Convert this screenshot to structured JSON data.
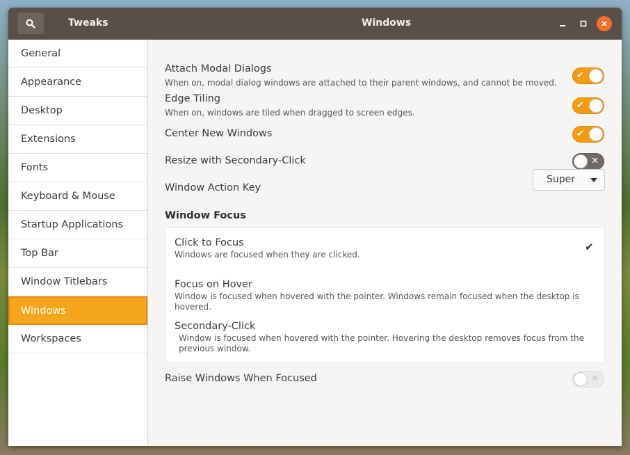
{
  "titlebar": {
    "app_title": "Tweaks",
    "page_title": "Windows",
    "search_icon": "search-icon",
    "minimize_icon": "minimize-icon",
    "maximize_icon": "maximize-icon",
    "close_icon": "close-icon",
    "close_color": "#ef6f2d"
  },
  "sidebar": {
    "items": [
      {
        "label": "General"
      },
      {
        "label": "Appearance"
      },
      {
        "label": "Desktop"
      },
      {
        "label": "Extensions"
      },
      {
        "label": "Fonts"
      },
      {
        "label": "Keyboard & Mouse"
      },
      {
        "label": "Startup Applications"
      },
      {
        "label": "Top Bar"
      },
      {
        "label": "Window Titlebars"
      },
      {
        "label": "Windows"
      },
      {
        "label": "Workspaces"
      }
    ],
    "active": "Windows",
    "active_color": "#f5a51c"
  },
  "settings": {
    "attach_modal": {
      "title": "Attach Modal Dialogs",
      "subtitle": "When on, modal dialog windows are attached to their parent windows, and cannot be moved.",
      "state": "on"
    },
    "edge_tiling": {
      "title": "Edge Tiling",
      "subtitle": "When on, windows are tiled when dragged to screen edges.",
      "state": "on"
    },
    "center_new": {
      "title": "Center New Windows",
      "state": "on"
    },
    "resize_secondary": {
      "title": "Resize with Secondary-Click",
      "state": "off"
    },
    "window_action_key": {
      "title": "Window Action Key",
      "value": "Super"
    },
    "window_focus": {
      "title": "Window Focus",
      "options": [
        {
          "title": "Click to Focus",
          "subtitle": "Windows are focused when they are clicked.",
          "selected": true
        },
        {
          "title": "Focus on Hover",
          "subtitle": "Window is focused when hovered with the pointer. Windows remain focused when the desktop is hovered.",
          "selected": false
        },
        {
          "title": "Secondary-Click",
          "subtitle": "Window is focused when hovered with the pointer. Hovering the desktop removes focus from the previous window.",
          "selected": false
        }
      ]
    },
    "raise_focused": {
      "title": "Raise Windows When Focused",
      "state": "off-disabled"
    }
  },
  "toggle_on_color": "#f39c12"
}
